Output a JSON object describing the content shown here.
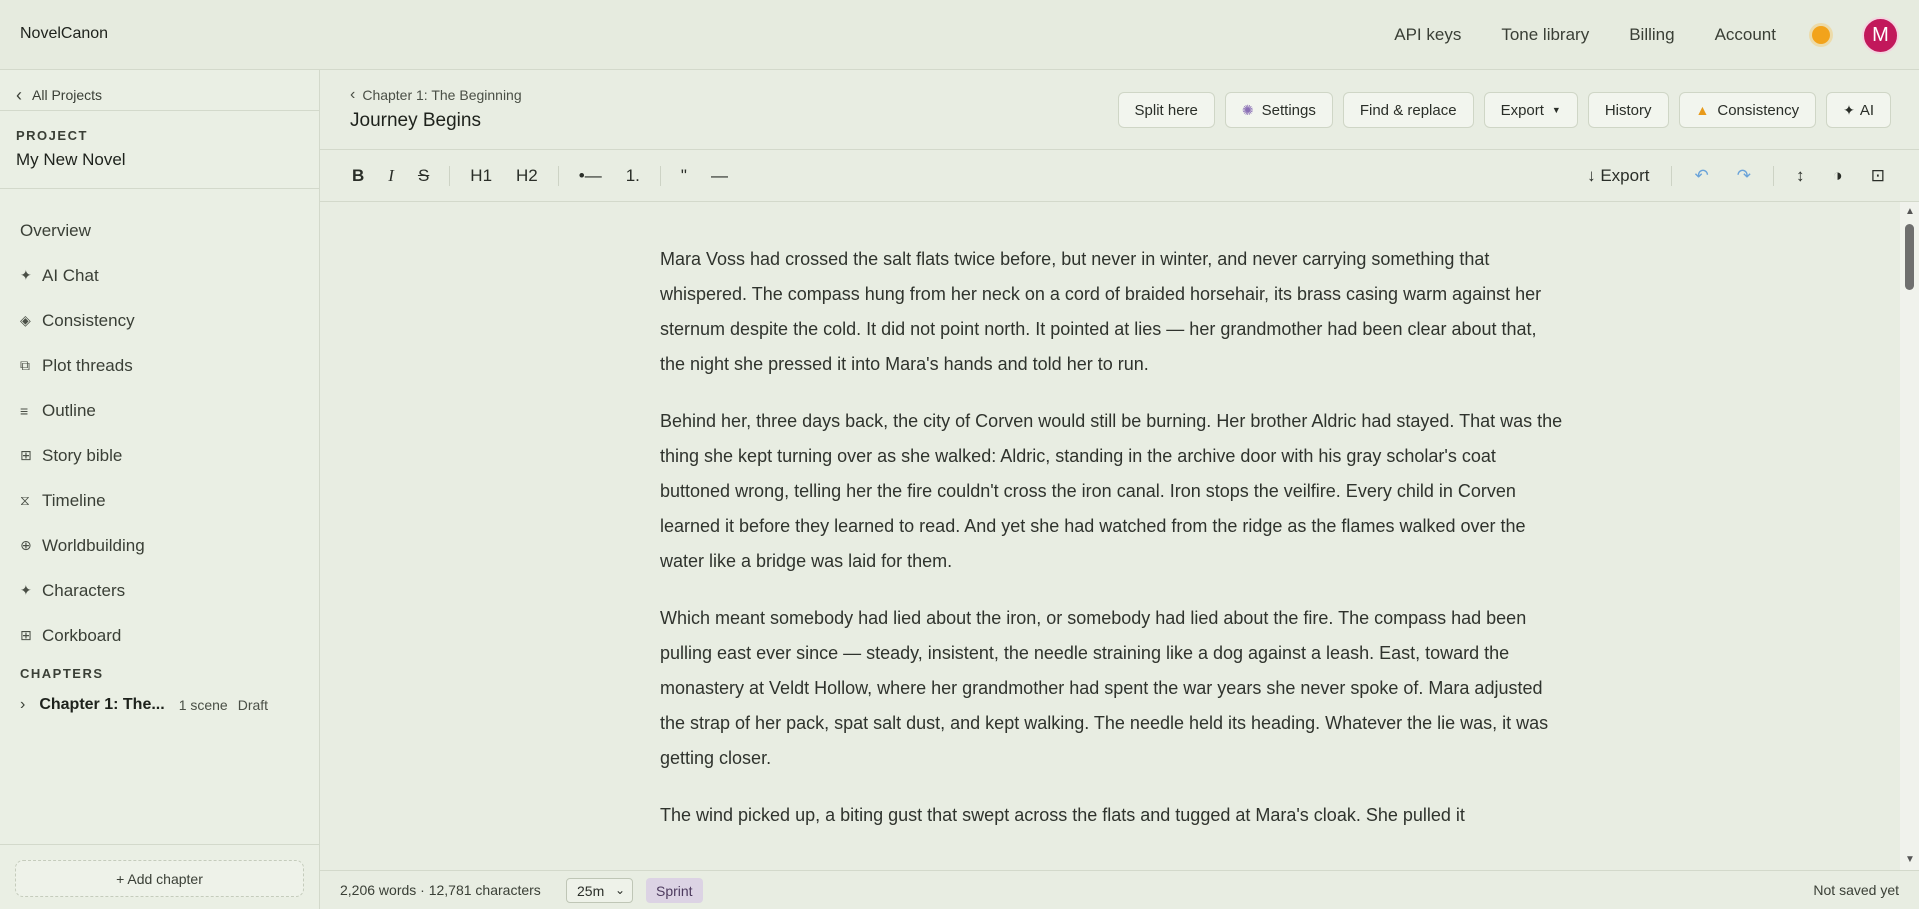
{
  "topbar": {
    "brand": "NovelCanon",
    "nav": [
      "API keys",
      "Tone library",
      "Billing",
      "Account"
    ],
    "avatar_initial": "M"
  },
  "sidebar": {
    "all_projects": "All Projects",
    "project_label": "PROJECT",
    "project_name": "My New Novel",
    "items": [
      {
        "label": "Overview",
        "icon": ""
      },
      {
        "label": "AI Chat",
        "icon": "✦"
      },
      {
        "label": "Consistency",
        "icon": "◈"
      },
      {
        "label": "Plot threads",
        "icon": "⧉"
      },
      {
        "label": "Outline",
        "icon": "≡"
      },
      {
        "label": "Story bible",
        "icon": "⊞"
      },
      {
        "label": "Timeline",
        "icon": "⧖"
      },
      {
        "label": "Worldbuilding",
        "icon": "⊕"
      },
      {
        "label": "Characters",
        "icon": "✦"
      },
      {
        "label": "Corkboard",
        "icon": "⊞"
      }
    ],
    "chapters_label": "CHAPTERS",
    "chapter": {
      "title": "Chapter 1: The...",
      "scenes": "1 scene",
      "status": "Draft"
    },
    "add_chapter": "+ Add chapter"
  },
  "header": {
    "breadcrumb": "Chapter 1: The Beginning",
    "scene_title": "Journey Begins",
    "actions": {
      "split": "Split here",
      "settings": "Settings",
      "find_replace": "Find & replace",
      "export": "Export",
      "history": "History",
      "consistency": "Consistency",
      "ai": "AI"
    }
  },
  "toolbar": {
    "bold": "B",
    "italic": "I",
    "strike": "S",
    "h1": "H1",
    "h2": "H2",
    "bullet": "•—",
    "ordered": "1.",
    "quote": "\"",
    "hr": "—",
    "export": "↓ Export"
  },
  "editor": {
    "paragraphs": [
      "Mara Voss had crossed the salt flats twice before, but never in winter, and never carrying something that whispered. The compass hung from her neck on a cord of braided horsehair, its brass casing warm against her sternum despite the cold. It did not point north. It pointed at lies — her grandmother had been clear about that, the night she pressed it into Mara's hands and told her to run.",
      "Behind her, three days back, the city of Corven would still be burning. Her brother Aldric had stayed. That was the thing she kept turning over as she walked: Aldric, standing in the archive door with his gray scholar's coat buttoned wrong, telling her the fire couldn't cross the iron canal. Iron stops the veilfire. Every child in Corven learned it before they learned to read. And yet she had watched from the ridge as the flames walked over the water like a bridge was laid for them.",
      "Which meant somebody had lied about the iron, or somebody had lied about the fire. The compass had been pulling east ever since — steady, insistent, the needle straining like a dog against a leash. East, toward the monastery at Veldt Hollow, where her grandmother had spent the war years she never spoke of. Mara adjusted the strap of her pack, spat salt dust, and kept walking. The needle held its heading. Whatever the lie was, it was getting closer.",
      "The wind picked up, a biting gust that swept across the flats and tugged at Mara's cloak. She pulled it"
    ]
  },
  "status": {
    "stats": "2,206 words · 12,781 characters",
    "duration": "25m",
    "sprint": "Sprint",
    "save_state": "Not saved yet"
  },
  "colors": {
    "avatar": "#c2185b",
    "sun": "#f2a31b",
    "sprint_bg": "#dcd3e4"
  }
}
